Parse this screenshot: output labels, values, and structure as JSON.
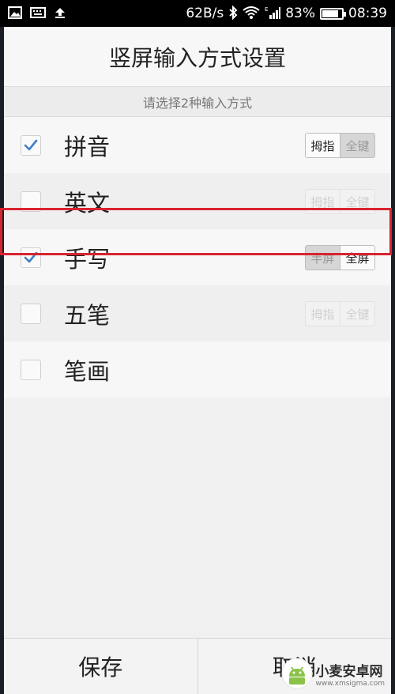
{
  "status_bar": {
    "network_speed": "62B/s",
    "battery": "83%",
    "battery_level": 0.83,
    "time": "08:39",
    "icons": [
      "gallery-icon",
      "keyboard-icon",
      "upload-icon",
      "bluetooth-icon",
      "wifi-icon",
      "signal-icon",
      "battery-icon"
    ]
  },
  "dialog": {
    "title": "竖屏输入方式设置",
    "subtitle": "请选择2种输入方式",
    "options": [
      {
        "label": "拼音",
        "checked": true,
        "toggle": [
          "拇指",
          "全键"
        ],
        "active": 0,
        "enabled": true
      },
      {
        "label": "英文",
        "checked": false,
        "toggle": [
          "拇指",
          "全键"
        ],
        "active": null,
        "enabled": false
      },
      {
        "label": "手写",
        "checked": true,
        "toggle": [
          "半屏",
          "全屏"
        ],
        "active": 1,
        "enabled": true
      },
      {
        "label": "五笔",
        "checked": false,
        "toggle": [
          "拇指",
          "全键"
        ],
        "active": null,
        "enabled": false
      },
      {
        "label": "笔画",
        "checked": false,
        "toggle": null,
        "active": null,
        "enabled": false
      }
    ],
    "save_label": "保存",
    "cancel_label": "取消"
  },
  "watermark": {
    "title": "小麦安卓网",
    "url": "www.xmsigma.com"
  },
  "colors": {
    "check": "#3f7fc6",
    "highlight": "#d8242f"
  }
}
